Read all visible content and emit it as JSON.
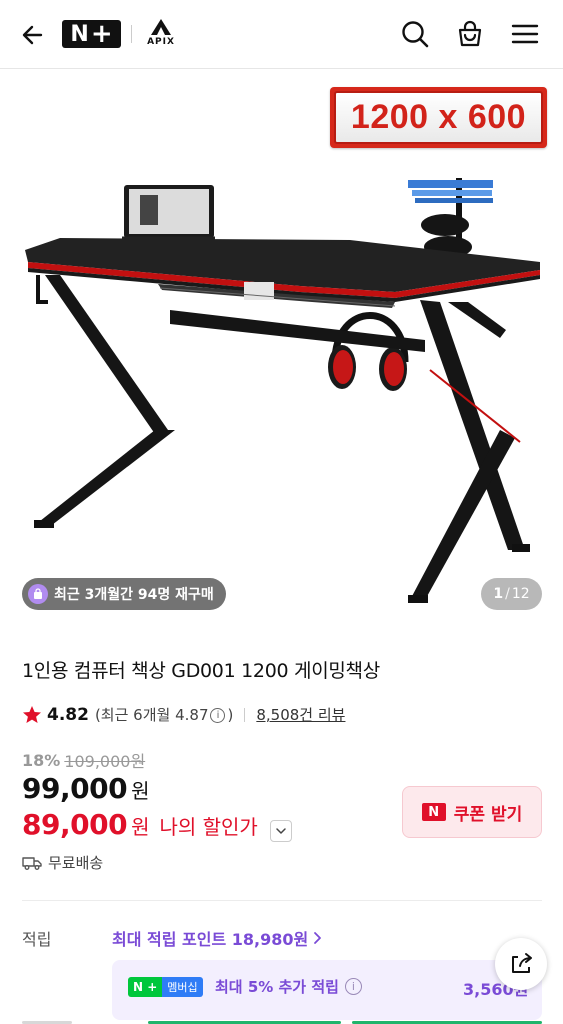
{
  "header": {
    "back_icon": "arrow-left-icon",
    "store_logo": "N+",
    "brand_logo_text": "APIX",
    "icons": [
      "search-icon",
      "shopping-bag-icon",
      "hamburger-menu-icon"
    ]
  },
  "hero": {
    "size_badge": "1200 x 600",
    "rebuy_text": "최근 3개월간 94명 재구매",
    "page_current": "1",
    "page_sep": "/",
    "page_total": "12"
  },
  "product": {
    "title": "1인용 컴퓨터 책상 GD001 1200 게이밍책상",
    "rating": "4.82",
    "recent_rating_prefix": "(최근 6개월 4.87",
    "recent_rating_suffix": ")",
    "reviews": "8,508건 리뷰",
    "discount_pct": "18%",
    "original_price": "109,000원",
    "price": "99,000",
    "price_unit": "원",
    "my_price": "89,000",
    "my_price_unit": "원",
    "my_price_label": "나의 할인가",
    "coupon_button": "쿠폰 받기",
    "coupon_badge": "N",
    "shipping": "무료배송"
  },
  "points": {
    "label": "적립",
    "max_points": "최대 적립 포인트 18,980원",
    "member_tag_a": "N +",
    "member_tag_b": "멤버십",
    "member_text": "최대 5% 추가 적립",
    "member_amount": "3,560원"
  },
  "colors": {
    "accent_red": "#e0102a",
    "accent_purple": "#7a4bd6",
    "member_bg": "#f3effe",
    "naver_green": "#00c73c"
  }
}
